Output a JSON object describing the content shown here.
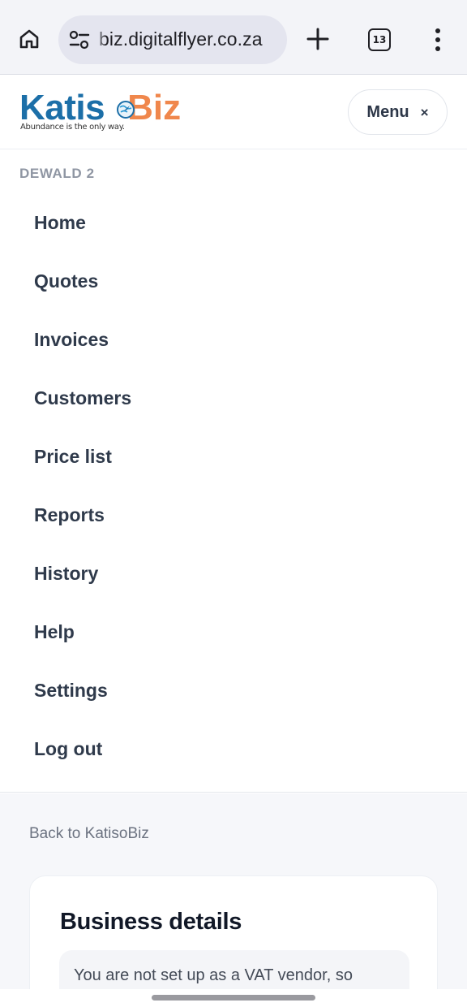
{
  "browser": {
    "url": "biz.digitalflyer.co.za",
    "tab_count": "13",
    "icons": [
      "home-icon",
      "site-settings-icon",
      "plus-icon",
      "tabs-icon",
      "more-vertical-icon"
    ]
  },
  "header": {
    "logo_part1": "Katis",
    "logo_part2": "Biz",
    "logo_tagline": "Abundance is the only way.",
    "menu_label": "Menu",
    "menu_close": "×"
  },
  "nav": {
    "user": "DEWALD 2",
    "items": [
      {
        "label": "Home"
      },
      {
        "label": "Quotes"
      },
      {
        "label": "Invoices"
      },
      {
        "label": "Customers"
      },
      {
        "label": "Price list"
      },
      {
        "label": "Reports"
      },
      {
        "label": "History"
      },
      {
        "label": "Help"
      },
      {
        "label": "Settings"
      },
      {
        "label": "Log out"
      }
    ]
  },
  "main": {
    "back_link": "Back to KatisoBiz",
    "card_title": "Business details",
    "notice": "You are not set up as a VAT vendor, so"
  },
  "colors": {
    "brand_blue": "#1c6fa8",
    "brand_orange": "#f0874c",
    "nav_text": "#2f3a4b",
    "muted": "#8f96a3"
  }
}
